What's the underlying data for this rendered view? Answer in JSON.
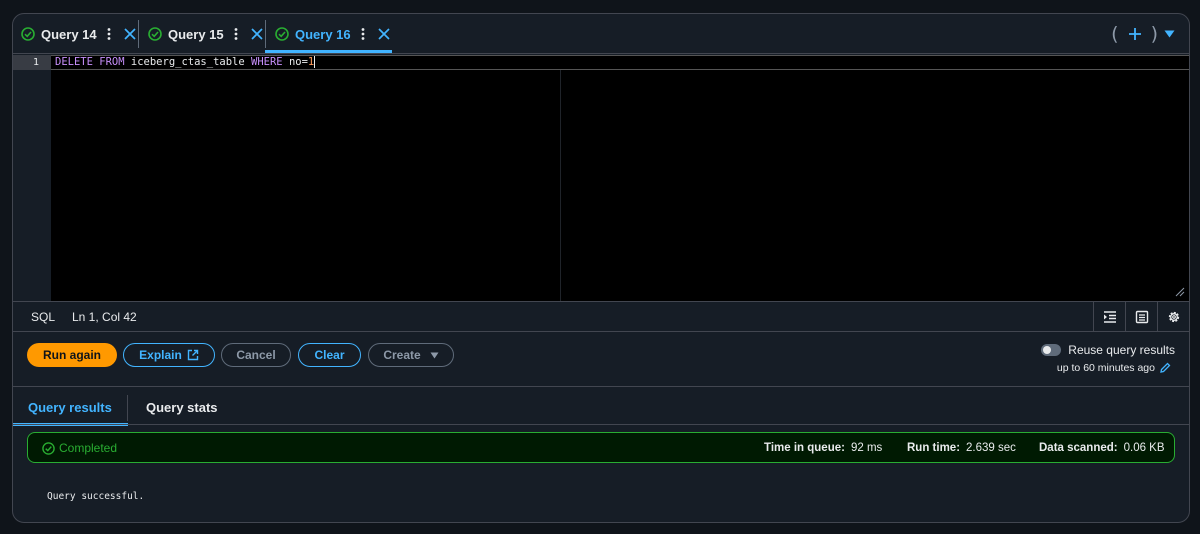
{
  "tabs": [
    {
      "label": "Query 14",
      "active": false
    },
    {
      "label": "Query 15",
      "active": false
    },
    {
      "label": "Query 16",
      "active": true
    }
  ],
  "editor": {
    "line_number": "1",
    "code": {
      "kw1": "DELETE",
      "kw2": "FROM",
      "table": "iceberg_ctas_table",
      "kw3": "WHERE",
      "cond": "no=",
      "value": "1"
    }
  },
  "statusbar": {
    "language": "SQL",
    "position": "Ln 1, Col 42"
  },
  "actions": {
    "run_again": "Run again",
    "explain": "Explain",
    "cancel": "Cancel",
    "clear": "Clear",
    "create": "Create"
  },
  "reuse": {
    "label": "Reuse query results",
    "sub": "up to 60 minutes ago",
    "enabled": false
  },
  "result_tabs": {
    "results": "Query results",
    "stats": "Query stats"
  },
  "status": {
    "text": "Completed",
    "time_in_queue_label": "Time in queue:",
    "time_in_queue": "92 ms",
    "run_time_label": "Run time:",
    "run_time": "2.639 sec",
    "data_scanned_label": "Data scanned:",
    "data_scanned": "0.06 KB"
  },
  "result_message": "Query successful.",
  "colors": {
    "accent": "#42b4ff",
    "primary": "#ff9900",
    "success": "#29ad32",
    "keyword": "#c78ffb",
    "number": "#ff9b5b"
  }
}
